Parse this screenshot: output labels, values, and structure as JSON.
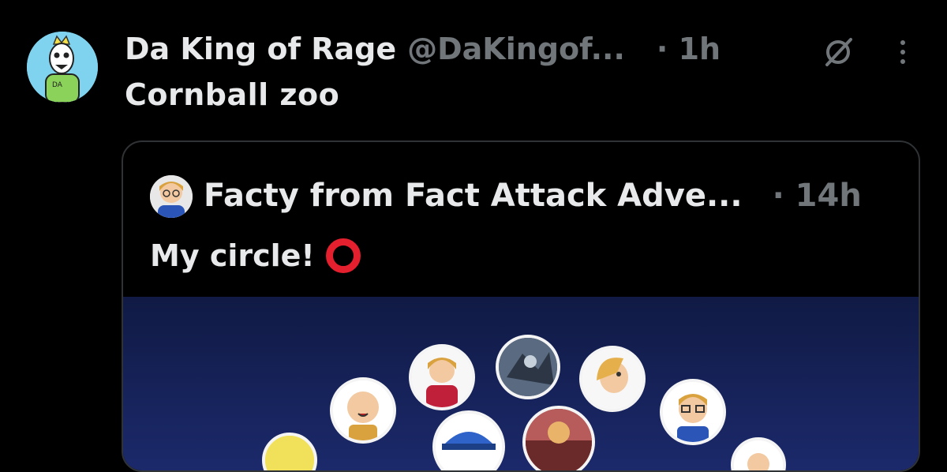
{
  "post": {
    "author_name": "Da King of Rage",
    "author_handle": "@DaKingof...",
    "time": "· 1h",
    "text": "Cornball zoo"
  },
  "quoted_post": {
    "author_name": "Facty from Fact Attack Adve...",
    "time": "· 14h",
    "text": "My circle!"
  },
  "icons": {
    "grok": "grok-icon",
    "more": "more-icon",
    "emoji": "hollow-red-circle"
  },
  "colors": {
    "background": "#000000",
    "text_primary": "#e7e9ea",
    "text_secondary": "#71767b",
    "border": "#2f3336",
    "media_bg": "#1c2a6d"
  }
}
